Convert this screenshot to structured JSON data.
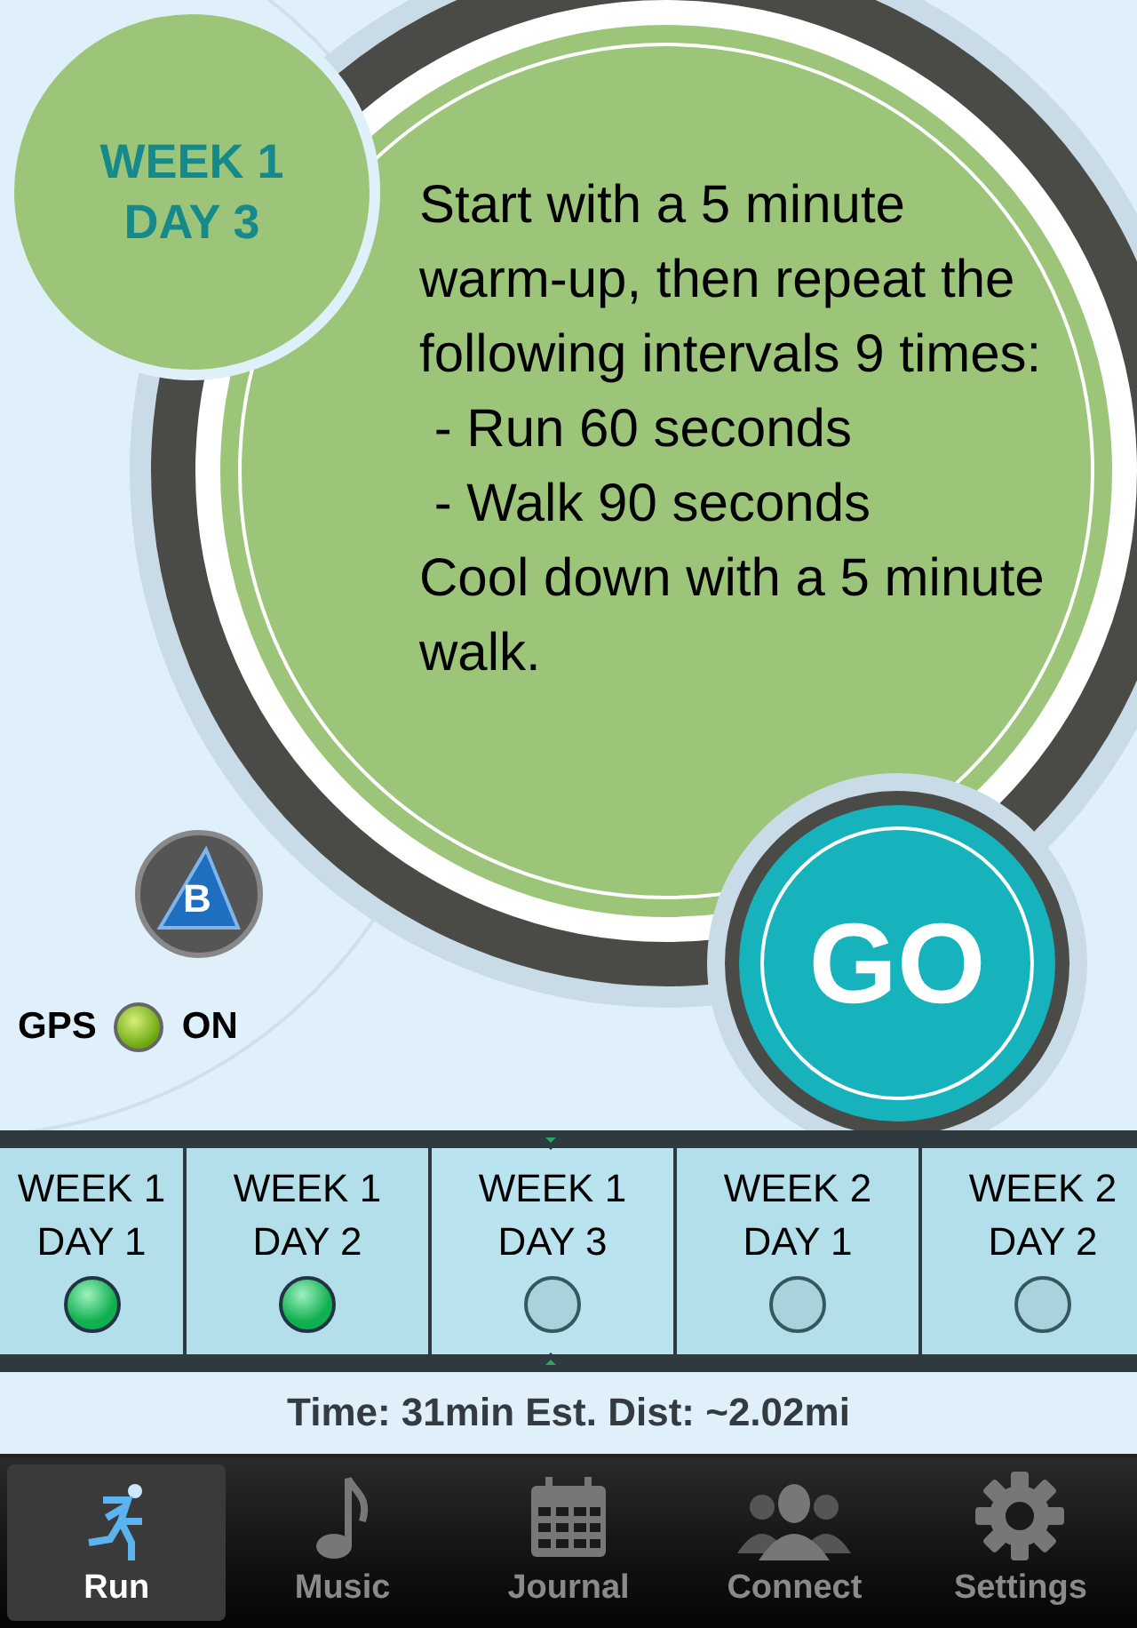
{
  "workout": {
    "week_label": "WEEK 1",
    "day_label": "DAY 3",
    "instructions": [
      "Start with a 5 minute warm-up, then repeat the following intervals 9 times:",
      " - Run 60 seconds",
      " - Walk 90 seconds",
      "Cool down with a 5 minute walk."
    ],
    "go_label": "GO",
    "logo_letter": "B"
  },
  "gps": {
    "label": "GPS",
    "on": true,
    "state": "ON"
  },
  "days": [
    {
      "week": "WEEK 1",
      "day": "DAY 1",
      "completed": true,
      "selected": false
    },
    {
      "week": "WEEK 1",
      "day": "DAY 2",
      "completed": true,
      "selected": false
    },
    {
      "week": "WEEK 1",
      "day": "DAY 3",
      "completed": false,
      "selected": true
    },
    {
      "week": "WEEK 2",
      "day": "DAY 1",
      "completed": false,
      "selected": false
    },
    {
      "week": "WEEK 2",
      "day": "DAY 2",
      "completed": false,
      "selected": false
    }
  ],
  "summary": "Time: 31min Est. Dist: ~2.02mi",
  "tabs": [
    {
      "label": "Run",
      "kind": "run",
      "selected": true
    },
    {
      "label": "Music",
      "kind": "music",
      "selected": false
    },
    {
      "label": "Journal",
      "kind": "journal",
      "selected": false
    },
    {
      "label": "Connect",
      "kind": "connect",
      "selected": false
    },
    {
      "label": "Settings",
      "kind": "settings",
      "selected": false
    }
  ]
}
